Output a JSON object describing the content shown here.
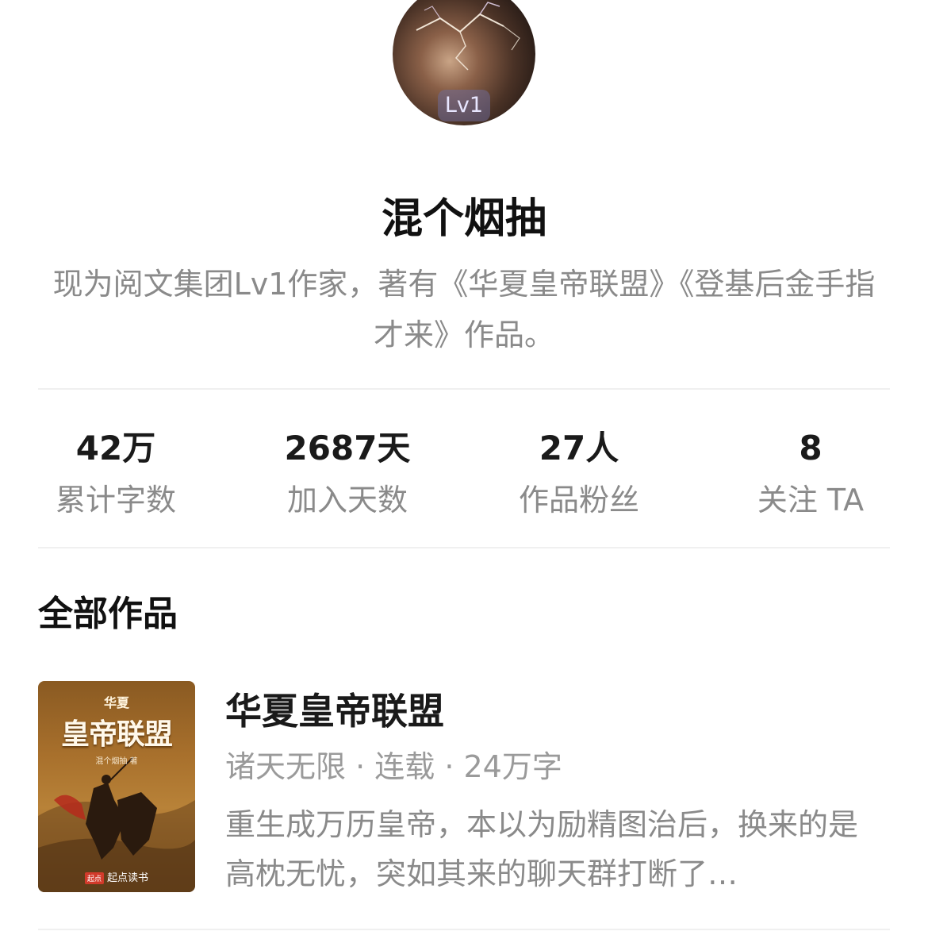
{
  "author": {
    "level_badge": "Lv1",
    "name": "混个烟抽",
    "bio": "现为阅文集团Lv1作家，著有《华夏皇帝联盟》《登基后金手指才来》作品。"
  },
  "stats": [
    {
      "value": "42万",
      "label": "累计字数"
    },
    {
      "value": "2687天",
      "label": "加入天数"
    },
    {
      "value": "27人",
      "label": "作品粉丝"
    },
    {
      "value": "8",
      "label": "关注 TA"
    }
  ],
  "works": {
    "section_title": "全部作品",
    "books": [
      {
        "title": "华夏皇帝联盟",
        "meta": "诸天无限 · 连载 · 24万字",
        "description": "重生成万历皇帝，本以为励精图治后，换来的是高枕无忧，突如其来的聊天群打断了…",
        "cover": {
          "small_text": "华夏",
          "title": "皇帝联盟",
          "author": "混个烟抽 著",
          "brand_tag": "起点",
          "brand": "起点读书"
        }
      }
    ]
  },
  "icons": {
    "avatar": "lightning-storm-avatar"
  }
}
